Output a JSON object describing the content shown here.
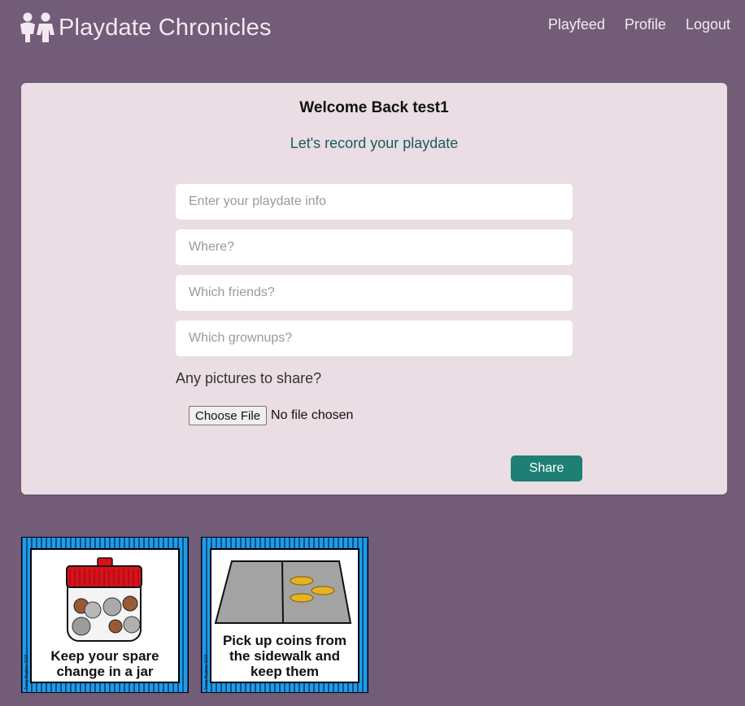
{
  "navbar": {
    "brand": "Playdate Chronicles",
    "brand_icon": "children-icon",
    "links": [
      {
        "label": "Playfeed"
      },
      {
        "label": "Profile"
      },
      {
        "label": "Logout"
      }
    ]
  },
  "form": {
    "welcome": "Welcome Back test1",
    "subtitle": "Let's record your playdate",
    "fields": [
      {
        "placeholder": "Enter your playdate info",
        "value": ""
      },
      {
        "placeholder": "Where?",
        "value": ""
      },
      {
        "placeholder": "Which friends?",
        "value": ""
      },
      {
        "placeholder": "Which grownups?",
        "value": ""
      }
    ],
    "pictures_label": "Any pictures to share?",
    "choose_file_label": "Choose File",
    "file_status": "No file chosen",
    "share_label": "Share"
  },
  "photos": [
    {
      "caption_line1": "Keep your spare",
      "caption_line2": "change in a jar",
      "credit": "Tracy Hughes 2015"
    },
    {
      "caption_line1": "Pick up coins from",
      "caption_line2": "the sidewalk and",
      "caption_line3": "keep them",
      "credit": "Tracy Hughes 2015"
    }
  ],
  "colors": {
    "background": "#735c78",
    "card": "#eaddE4",
    "subtitle": "#1d5a5a",
    "share_button": "#1e8074",
    "photo_border": "#1f9be8"
  }
}
